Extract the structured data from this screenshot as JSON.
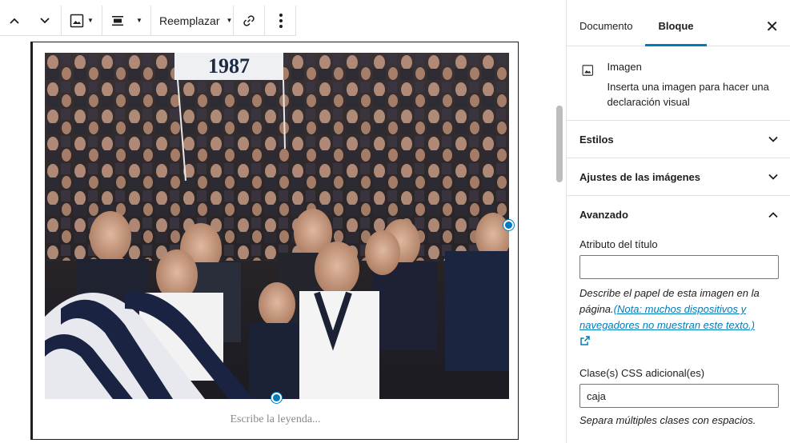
{
  "toolbar": {
    "replace_label": "Reemplazar"
  },
  "image": {
    "banner_text": "1987",
    "caption_placeholder": "Escribe la leyenda..."
  },
  "sidebar": {
    "tabs": [
      {
        "label": "Documento"
      },
      {
        "label": "Bloque"
      }
    ],
    "block_card": {
      "title": "Imagen",
      "description": "Inserta una imagen para hacer una declaración visual"
    },
    "panels": [
      {
        "title": "Estilos"
      },
      {
        "title": "Ajustes de las imágenes"
      },
      {
        "title": "Avanzado"
      }
    ],
    "advanced": {
      "title_attr_label": "Atributo del título",
      "title_attr_value": "",
      "title_attr_help": "Describe el papel de esta imagen en la página.",
      "title_attr_link": "(Nota: muchos dispositivos y navegadores no muestran este texto.)",
      "css_label": "Clase(s) CSS adicional(es)",
      "css_value": "caja",
      "css_help": "Separa múltiples clases con espacios."
    }
  },
  "colors": {
    "accent": "#007cba"
  }
}
